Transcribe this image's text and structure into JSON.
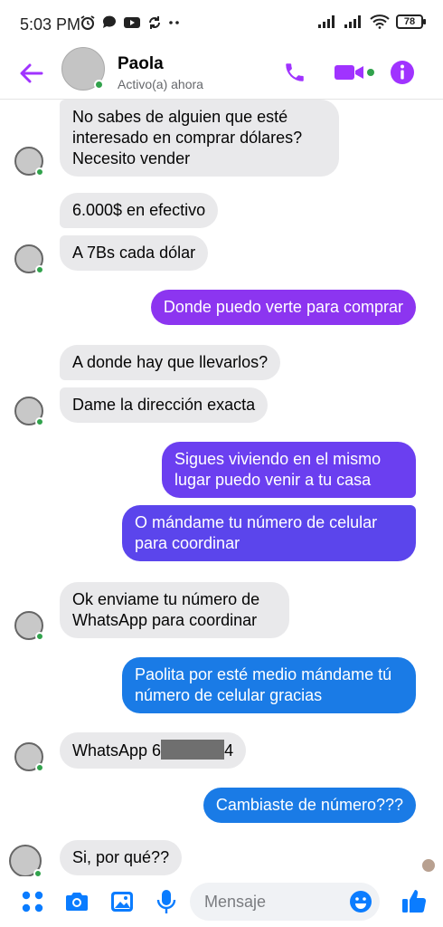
{
  "status_bar": {
    "time": "5:03 PM",
    "battery": "78"
  },
  "header": {
    "contact_name": "Paola",
    "contact_status": "Activo(a) ahora"
  },
  "colors": {
    "accent": "#a033ff",
    "outgoing_purple": "#8c35f0",
    "outgoing_indigo": "#5b45ec",
    "outgoing_blue": "#1a7be6",
    "incoming": "#e9e9eb",
    "online": "#31a24c"
  },
  "messages": [
    {
      "direction": "in",
      "text": "No sabes de alguien que esté interesado en comprar dólares? Necesito vender"
    },
    {
      "direction": "in",
      "text": "6.000$ en efectivo"
    },
    {
      "direction": "in",
      "text": "A 7Bs cada dólar"
    },
    {
      "direction": "out",
      "text": "Donde puedo verte para comprar"
    },
    {
      "direction": "in",
      "text": "A donde hay que llevarlos?"
    },
    {
      "direction": "in",
      "text": "Dame la dirección exacta"
    },
    {
      "direction": "out",
      "text": "Sigues viviendo en el mismo lugar puedo venir a tu casa"
    },
    {
      "direction": "out",
      "text": "O mándame tu número de celular para coordinar"
    },
    {
      "direction": "in",
      "text": "Ok enviame tu número de WhatsApp para coordinar"
    },
    {
      "direction": "out",
      "text": "Paolita por esté medio mándame tú número de celular gracias"
    },
    {
      "direction": "in",
      "text_before": "WhatsApp 6",
      "text_after": "4"
    },
    {
      "direction": "out",
      "text": "Cambiaste de número???"
    },
    {
      "direction": "in",
      "text": "Si, por qué??"
    }
  ],
  "composer": {
    "placeholder": "Mensaje",
    "icons": [
      "apps-icon",
      "camera-icon",
      "gallery-icon",
      "microphone-icon",
      "emoji-icon",
      "thumbs-up-icon"
    ]
  }
}
